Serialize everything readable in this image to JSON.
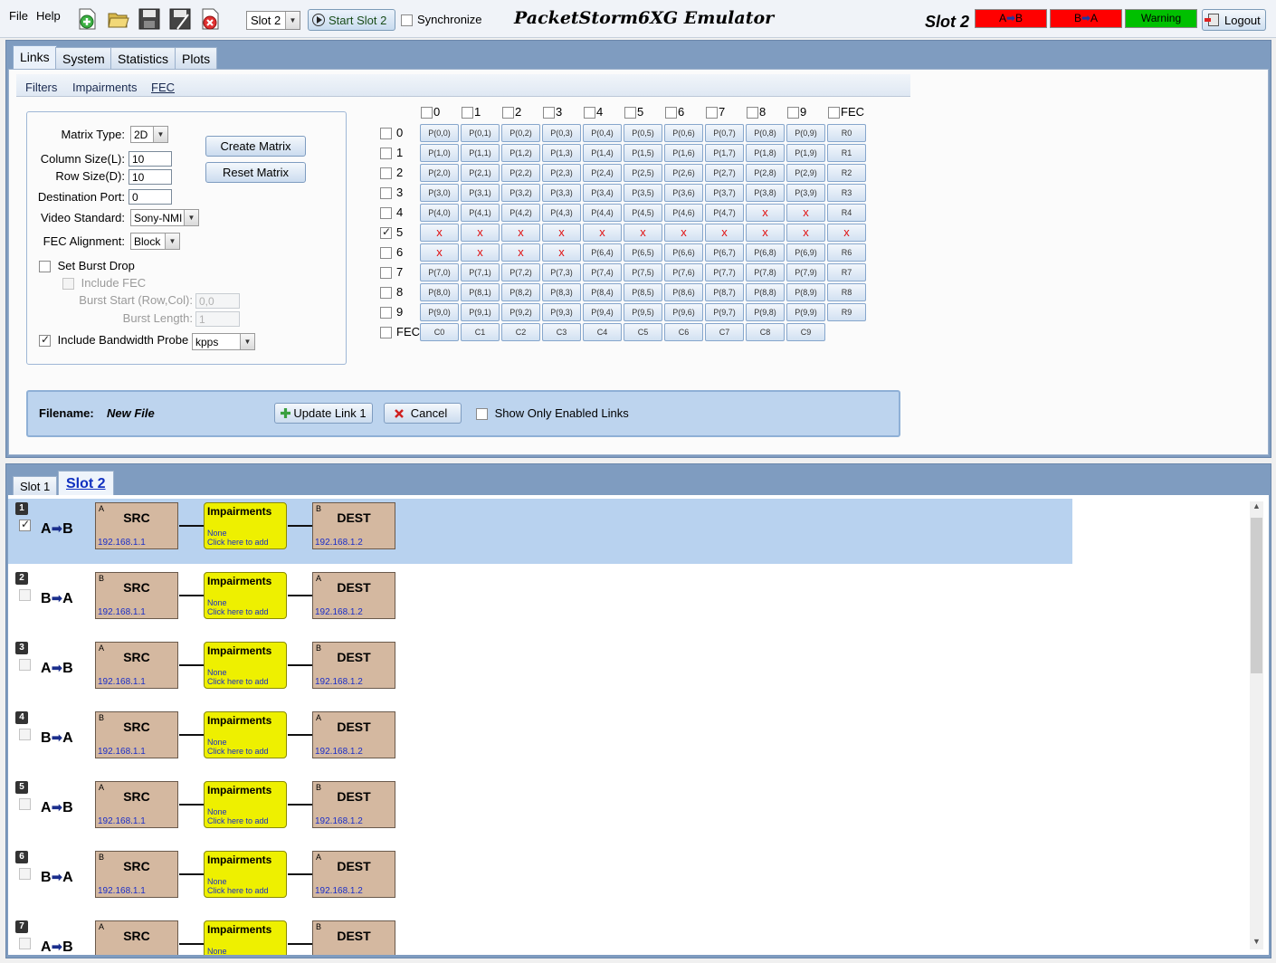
{
  "menu": {
    "file": "File",
    "help": "Help"
  },
  "toolbar": {
    "icons": [
      "add-file-icon",
      "open-folder-icon",
      "save-icon",
      "save-as-icon",
      "delete-icon"
    ],
    "slot_select": "Slot 2",
    "start_button": "Start Slot 2",
    "synchronize": "Synchronize",
    "app_title": "PacketStorm6XG Emulator",
    "slot_label": "Slot 2",
    "status": [
      {
        "from": "A",
        "to": "B",
        "color": "#ff0000"
      },
      {
        "from": "B",
        "to": "A",
        "color": "#ff0000"
      },
      {
        "label": "Warning",
        "color": "#00c000"
      }
    ],
    "logout": "Logout"
  },
  "main_tabs": [
    "Links",
    "System",
    "Statistics",
    "Plots"
  ],
  "sub_tabs": [
    "Filters",
    "Impairments",
    "FEC"
  ],
  "fec_config": {
    "matrix_type_label": "Matrix Type:",
    "matrix_type": "2D",
    "column_size_label": "Column Size(L):",
    "column_size": "10",
    "row_size_label": "Row Size(D):",
    "row_size": "10",
    "dest_port_label": "Destination Port:",
    "dest_port": "0",
    "video_standard_label": "Video Standard:",
    "video_standard": "Sony-NMI",
    "fec_alignment_label": "FEC Alignment:",
    "fec_alignment": "Block",
    "create_matrix": "Create Matrix",
    "reset_matrix": "Reset Matrix",
    "set_burst_drop": "Set Burst Drop",
    "include_fec": "Include FEC",
    "burst_start_label": "Burst Start (Row,Col):",
    "burst_start": "0,0",
    "burst_length_label": "Burst Length:",
    "burst_length": "1",
    "include_bw_probe": "Include Bandwidth Probe",
    "bw_unit": "kpps"
  },
  "matrix": {
    "col_headers": [
      "0",
      "1",
      "2",
      "3",
      "4",
      "5",
      "6",
      "7",
      "8",
      "9",
      "FEC"
    ],
    "row_headers": [
      "0",
      "1",
      "2",
      "3",
      "4",
      "5",
      "6",
      "7",
      "8",
      "9",
      "FEC"
    ],
    "checked_rows": [
      5
    ],
    "dropped": {
      "4": [
        8,
        9
      ],
      "5": [
        0,
        1,
        2,
        3,
        4,
        5,
        6,
        7,
        8,
        9,
        10
      ],
      "6": [
        0,
        1,
        2,
        3
      ]
    },
    "x_mark": "x",
    "row_fec_prefix": "R",
    "col_fec_prefix": "C"
  },
  "filebar": {
    "filename_label": "Filename:",
    "filename": "New File",
    "update_button": "Update Link 1",
    "cancel_button": "Cancel",
    "show_only_enabled": "Show Only Enabled Links"
  },
  "slot_tabs": [
    "Slot 1",
    "Slot 2"
  ],
  "links": [
    {
      "num": "1",
      "dir_from": "A",
      "dir_to": "B",
      "checked": true,
      "selected": true
    },
    {
      "num": "2",
      "dir_from": "B",
      "dir_to": "A",
      "checked": false,
      "selected": false
    },
    {
      "num": "3",
      "dir_from": "A",
      "dir_to": "B",
      "checked": false,
      "selected": false
    },
    {
      "num": "4",
      "dir_from": "B",
      "dir_to": "A",
      "checked": false,
      "selected": false
    },
    {
      "num": "5",
      "dir_from": "A",
      "dir_to": "B",
      "checked": false,
      "selected": false
    },
    {
      "num": "6",
      "dir_from": "B",
      "dir_to": "A",
      "checked": false,
      "selected": false
    },
    {
      "num": "7",
      "dir_from": "A",
      "dir_to": "B",
      "checked": false,
      "selected": false
    }
  ],
  "link_node": {
    "src": "SRC",
    "dest": "DEST",
    "src_ip": "192.168.1.1",
    "dest_ip": "192.168.1.2",
    "imp_title": "Impairments",
    "imp_none": "None",
    "imp_click": "Click here to add"
  }
}
